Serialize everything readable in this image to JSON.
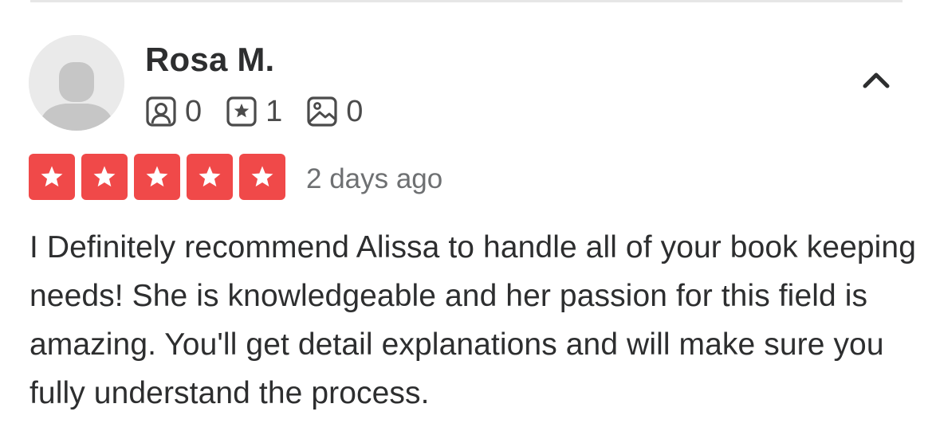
{
  "review": {
    "user": {
      "name": "Rosa M.",
      "avatar_icon": "default-avatar-icon"
    },
    "stats": [
      {
        "icon": "friends-icon",
        "count": "0"
      },
      {
        "icon": "reviews-star-icon",
        "count": "1"
      },
      {
        "icon": "photos-icon",
        "count": "0"
      }
    ],
    "rating": {
      "stars": 5,
      "max": 5,
      "star_color": "#f04949"
    },
    "date": "2 days ago",
    "text": "I Definitely recommend Alissa to handle all of your book keeping needs! She is knowledgeable and her passion for this field is amazing. You'll get detail explanations and will make sure you fully understand the process.",
    "collapse_icon": "chevron-up-icon"
  }
}
